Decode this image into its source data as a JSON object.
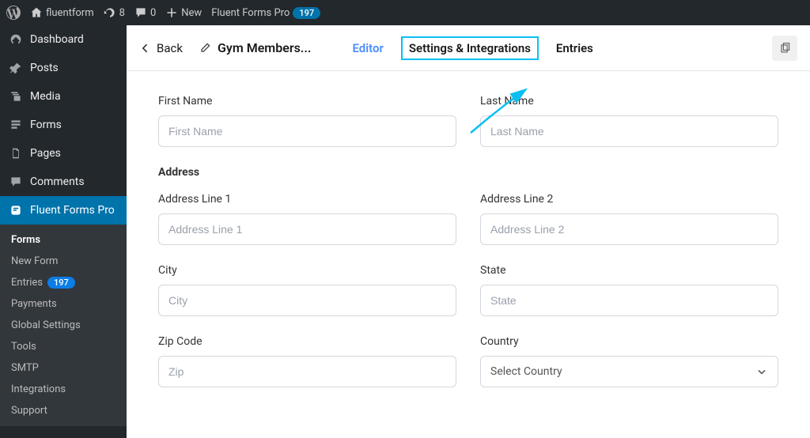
{
  "adminbar": {
    "site_name": "fluentform",
    "updates": "8",
    "comments": "0",
    "new_label": "New",
    "ff_label": "Fluent Forms Pro",
    "ff_badge": "197"
  },
  "sidebar": {
    "items": [
      {
        "label": "Dashboard",
        "icon": "dashboard"
      },
      {
        "label": "Posts",
        "icon": "pin"
      },
      {
        "label": "Media",
        "icon": "media"
      },
      {
        "label": "Forms",
        "icon": "forms"
      },
      {
        "label": "Pages",
        "icon": "page"
      },
      {
        "label": "Comments",
        "icon": "comment"
      },
      {
        "label": "Fluent Forms Pro",
        "icon": "fluent"
      }
    ],
    "submenu": [
      {
        "label": "Forms",
        "active": true
      },
      {
        "label": "New Form"
      },
      {
        "label": "Entries",
        "badge": "197"
      },
      {
        "label": "Payments"
      },
      {
        "label": "Global Settings"
      },
      {
        "label": "Tools"
      },
      {
        "label": "SMTP"
      },
      {
        "label": "Integrations"
      },
      {
        "label": "Support"
      }
    ]
  },
  "editor": {
    "back": "Back",
    "form_name": "Gym Members...",
    "tabs": {
      "editor": "Editor",
      "settings": "Settings & Integrations",
      "entries": "Entries"
    }
  },
  "form": {
    "first_name": {
      "label": "First Name",
      "placeholder": "First Name"
    },
    "last_name": {
      "label": "Last Name",
      "placeholder": "Last Name"
    },
    "address_title": "Address",
    "line1": {
      "label": "Address Line 1",
      "placeholder": "Address Line 1"
    },
    "line2": {
      "label": "Address Line 2",
      "placeholder": "Address Line 2"
    },
    "city": {
      "label": "City",
      "placeholder": "City"
    },
    "state": {
      "label": "State",
      "placeholder": "State"
    },
    "zip": {
      "label": "Zip Code",
      "placeholder": "Zip"
    },
    "country": {
      "label": "Country",
      "selected": "Select Country"
    }
  }
}
